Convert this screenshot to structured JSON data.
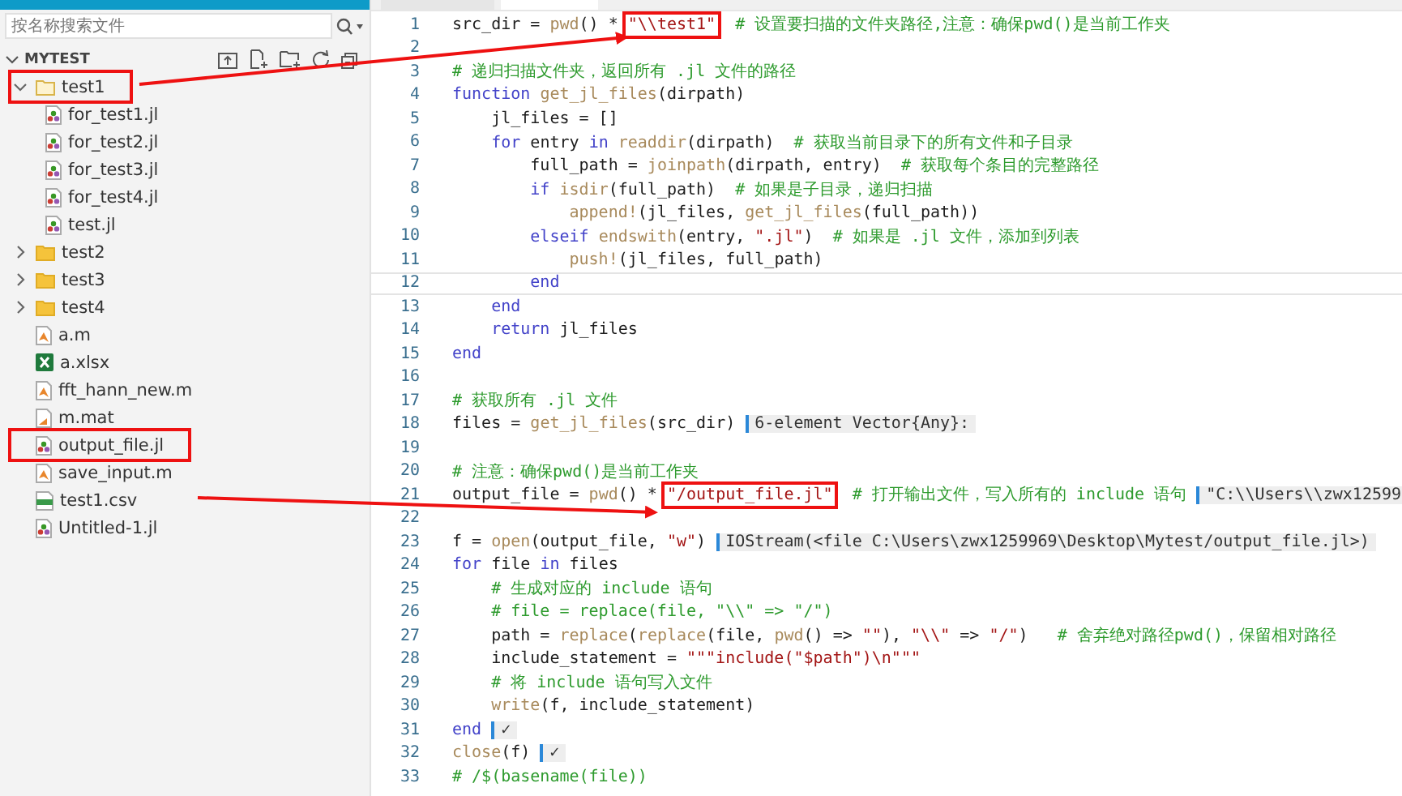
{
  "sidebar": {
    "search": {
      "placeholder": "按名称搜索文件"
    },
    "section": {
      "title": "MYTEST",
      "expanded": true
    },
    "tree": [
      {
        "name": "test1",
        "kind": "folder",
        "expanded": true,
        "annotated": true,
        "children": [
          {
            "name": "for_test1.jl",
            "kind": "julia",
            "annotated": false
          },
          {
            "name": "for_test2.jl",
            "kind": "julia",
            "annotated": false
          },
          {
            "name": "for_test3.jl",
            "kind": "julia",
            "annotated": false
          },
          {
            "name": "for_test4.jl",
            "kind": "julia",
            "annotated": false
          },
          {
            "name": "test.jl",
            "kind": "julia",
            "annotated": false
          }
        ]
      },
      {
        "name": "test2",
        "kind": "folder",
        "expanded": false,
        "annotated": false
      },
      {
        "name": "test3",
        "kind": "folder",
        "expanded": false,
        "annotated": false
      },
      {
        "name": "test4",
        "kind": "folder",
        "expanded": false,
        "annotated": false
      },
      {
        "name": "a.m",
        "kind": "matlab",
        "annotated": false
      },
      {
        "name": "a.xlsx",
        "kind": "excel",
        "annotated": false
      },
      {
        "name": "fft_hann_new.m",
        "kind": "matlab",
        "annotated": false
      },
      {
        "name": "m.mat",
        "kind": "mat",
        "annotated": false
      },
      {
        "name": "output_file.jl",
        "kind": "julia",
        "annotated": true
      },
      {
        "name": "save_input.m",
        "kind": "matlab",
        "annotated": false
      },
      {
        "name": "test1.csv",
        "kind": "csv",
        "annotated": false
      },
      {
        "name": "Untitled-1.jl",
        "kind": "julia",
        "annotated": false
      }
    ]
  },
  "editor": {
    "lines": [
      {
        "number": "1",
        "current": false,
        "tokens": [
          {
            "kind": "plain",
            "text": "src_dir = "
          },
          {
            "kind": "function",
            "text": "pwd"
          },
          {
            "kind": "plain",
            "text": "() * "
          },
          {
            "kind": "string",
            "text": "\"\\\\test1\"",
            "annotated": true
          },
          {
            "kind": "comment",
            "text": "  # 设置要扫描的文件夹路径,注意：确保pwd()是当前工作夹"
          }
        ]
      },
      {
        "number": "2",
        "current": false
      },
      {
        "number": "3",
        "current": false,
        "tokens": [
          {
            "kind": "comment",
            "text": "# 递归扫描文件夹，返回所有 .jl 文件的路径"
          }
        ]
      },
      {
        "number": "4",
        "current": false,
        "tokens": [
          {
            "kind": "keyword",
            "text": "function "
          },
          {
            "kind": "function",
            "text": "get_jl_files"
          },
          {
            "kind": "plain",
            "text": "(dirpath)"
          }
        ]
      },
      {
        "number": "5",
        "current": false,
        "tokens": [
          {
            "kind": "plain",
            "text": "    jl_files = []"
          }
        ]
      },
      {
        "number": "6",
        "current": false,
        "tokens": [
          {
            "kind": "keyword",
            "text": "    for"
          },
          {
            "kind": "plain",
            "text": " entry "
          },
          {
            "kind": "keyword",
            "text": "in "
          },
          {
            "kind": "function",
            "text": "readdir"
          },
          {
            "kind": "plain",
            "text": "(dirpath)  "
          },
          {
            "kind": "comment",
            "text": "# 获取当前目录下的所有文件和子目录"
          }
        ]
      },
      {
        "number": "7",
        "current": false,
        "tokens": [
          {
            "kind": "plain",
            "text": "        full_path = "
          },
          {
            "kind": "function",
            "text": "joinpath"
          },
          {
            "kind": "plain",
            "text": "(dirpath, entry)  "
          },
          {
            "kind": "comment",
            "text": "# 获取每个条目的完整路径"
          }
        ]
      },
      {
        "number": "8",
        "current": false,
        "tokens": [
          {
            "kind": "keyword",
            "text": "        if "
          },
          {
            "kind": "function",
            "text": "isdir"
          },
          {
            "kind": "plain",
            "text": "(full_path)  "
          },
          {
            "kind": "comment",
            "text": "# 如果是子目录，递归扫描"
          }
        ]
      },
      {
        "number": "9",
        "current": false,
        "tokens": [
          {
            "kind": "function",
            "text": "            append!"
          },
          {
            "kind": "plain",
            "text": "(jl_files, "
          },
          {
            "kind": "function",
            "text": "get_jl_files"
          },
          {
            "kind": "plain",
            "text": "(full_path))"
          }
        ]
      },
      {
        "number": "10",
        "current": false,
        "tokens": [
          {
            "kind": "keyword",
            "text": "        elseif "
          },
          {
            "kind": "function",
            "text": "endswith"
          },
          {
            "kind": "plain",
            "text": "(entry, "
          },
          {
            "kind": "string",
            "text": "\".jl\""
          },
          {
            "kind": "plain",
            "text": ")  "
          },
          {
            "kind": "comment",
            "text": "# 如果是 .jl 文件，添加到列表"
          }
        ]
      },
      {
        "number": "11",
        "current": false,
        "tokens": [
          {
            "kind": "function",
            "text": "            push!"
          },
          {
            "kind": "plain",
            "text": "(jl_files, full_path)"
          }
        ]
      },
      {
        "number": "12",
        "current": true,
        "tokens": [
          {
            "kind": "keyword",
            "text": "        end"
          }
        ]
      },
      {
        "number": "13",
        "current": false,
        "tokens": [
          {
            "kind": "keyword",
            "text": "    end"
          }
        ]
      },
      {
        "number": "14",
        "current": false,
        "tokens": [
          {
            "kind": "keyword",
            "text": "    return"
          },
          {
            "kind": "plain",
            "text": " jl_files"
          }
        ]
      },
      {
        "number": "15",
        "current": false,
        "tokens": [
          {
            "kind": "keyword",
            "text": "end"
          }
        ]
      },
      {
        "number": "16",
        "current": false
      },
      {
        "number": "17",
        "current": false,
        "tokens": [
          {
            "kind": "comment",
            "text": "# 获取所有 .jl 文件"
          }
        ]
      },
      {
        "number": "18",
        "current": false,
        "tokens": [
          {
            "kind": "plain",
            "text": "files = "
          },
          {
            "kind": "function",
            "text": "get_jl_files"
          },
          {
            "kind": "plain",
            "text": "(src_dir)"
          }
        ],
        "result": "6-element Vector{Any}:"
      },
      {
        "number": "19",
        "current": false
      },
      {
        "number": "20",
        "current": false,
        "tokens": [
          {
            "kind": "comment",
            "text": "# 注意：确保pwd()是当前工作夹"
          }
        ]
      },
      {
        "number": "21",
        "current": false,
        "tokens": [
          {
            "kind": "plain",
            "text": "output_file = "
          },
          {
            "kind": "function",
            "text": "pwd"
          },
          {
            "kind": "plain",
            "text": "() * "
          },
          {
            "kind": "string",
            "text": "\"/output_file.jl\"",
            "annotated": true
          },
          {
            "kind": "comment",
            "text": "  # 打开输出文件，写入所有的 include 语句"
          }
        ],
        "result": "\"C:\\\\Users\\\\zwx12599"
      },
      {
        "number": "22",
        "current": false
      },
      {
        "number": "23",
        "current": false,
        "tokens": [
          {
            "kind": "plain",
            "text": "f = "
          },
          {
            "kind": "function",
            "text": "open"
          },
          {
            "kind": "plain",
            "text": "(output_file, "
          },
          {
            "kind": "string",
            "text": "\"w\""
          },
          {
            "kind": "plain",
            "text": ")"
          }
        ],
        "result": "IOStream(<file C:\\Users\\zwx1259969\\Desktop\\Mytest/output_file.jl>)"
      },
      {
        "number": "24",
        "current": false,
        "tokens": [
          {
            "kind": "keyword",
            "text": "for"
          },
          {
            "kind": "plain",
            "text": " file "
          },
          {
            "kind": "keyword",
            "text": "in"
          },
          {
            "kind": "plain",
            "text": " files"
          }
        ]
      },
      {
        "number": "25",
        "current": false,
        "tokens": [
          {
            "kind": "comment",
            "text": "    # 生成对应的 include 语句"
          }
        ]
      },
      {
        "number": "26",
        "current": false,
        "tokens": [
          {
            "kind": "comment",
            "text": "    # file = replace(file, \"\\\\\" => \"/\")"
          }
        ]
      },
      {
        "number": "27",
        "current": false,
        "tokens": [
          {
            "kind": "plain",
            "text": "    path = "
          },
          {
            "kind": "function",
            "text": "replace"
          },
          {
            "kind": "plain",
            "text": "("
          },
          {
            "kind": "function",
            "text": "replace"
          },
          {
            "kind": "plain",
            "text": "(file, "
          },
          {
            "kind": "function",
            "text": "pwd"
          },
          {
            "kind": "plain",
            "text": "() => "
          },
          {
            "kind": "string",
            "text": "\"\""
          },
          {
            "kind": "plain",
            "text": "), "
          },
          {
            "kind": "string",
            "text": "\"\\\\\""
          },
          {
            "kind": "plain",
            "text": " => "
          },
          {
            "kind": "string",
            "text": "\"/\""
          },
          {
            "kind": "plain",
            "text": ")   "
          },
          {
            "kind": "comment",
            "text": "# 舍弃绝对路径pwd()，保留相对路径"
          }
        ]
      },
      {
        "number": "28",
        "current": false,
        "tokens": [
          {
            "kind": "plain",
            "text": "    include_statement = "
          },
          {
            "kind": "string",
            "text": "\"\"\"include(\"$path\")\\n\"\"\""
          }
        ]
      },
      {
        "number": "29",
        "current": false,
        "tokens": [
          {
            "kind": "comment",
            "text": "    # 将 include 语句写入文件"
          }
        ]
      },
      {
        "number": "30",
        "current": false,
        "tokens": [
          {
            "kind": "function",
            "text": "    write"
          },
          {
            "kind": "plain",
            "text": "(f, include_statement)"
          }
        ]
      },
      {
        "number": "31",
        "current": false,
        "tokens": [
          {
            "kind": "keyword",
            "text": "end"
          }
        ],
        "result": "✓"
      },
      {
        "number": "32",
        "current": false,
        "tokens": [
          {
            "kind": "function",
            "text": "close"
          },
          {
            "kind": "plain",
            "text": "(f)"
          }
        ],
        "result": "✓"
      },
      {
        "number": "33",
        "current": false,
        "tokens": [
          {
            "kind": "comment",
            "text": "# /$(basename(file))"
          }
        ]
      }
    ]
  }
}
